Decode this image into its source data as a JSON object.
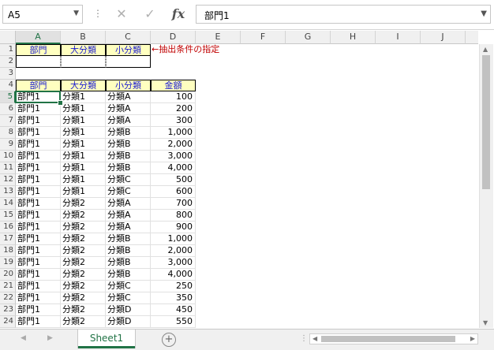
{
  "formula_bar": {
    "name_box": "A5",
    "formula": "部門1",
    "icons": [
      "cancel-icon",
      "enter-icon",
      "fx-icon"
    ]
  },
  "columns": [
    "A",
    "B",
    "C",
    "D",
    "E",
    "F",
    "G",
    "H",
    "I",
    "J"
  ],
  "criteria": {
    "headers": [
      "部門",
      "大分類",
      "小分類"
    ],
    "note": "←抽出条件の指定"
  },
  "list_headers": [
    "部門",
    "大分類",
    "小分類",
    "金額"
  ],
  "rows": [
    {
      "r": "5",
      "a": "部門1",
      "b": "分類1",
      "c": "分類A",
      "d": "100"
    },
    {
      "r": "6",
      "a": "部門1",
      "b": "分類1",
      "c": "分類A",
      "d": "200"
    },
    {
      "r": "7",
      "a": "部門1",
      "b": "分類1",
      "c": "分類A",
      "d": "300"
    },
    {
      "r": "8",
      "a": "部門1",
      "b": "分類1",
      "c": "分類B",
      "d": "1,000"
    },
    {
      "r": "9",
      "a": "部門1",
      "b": "分類1",
      "c": "分類B",
      "d": "2,000"
    },
    {
      "r": "10",
      "a": "部門1",
      "b": "分類1",
      "c": "分類B",
      "d": "3,000"
    },
    {
      "r": "11",
      "a": "部門1",
      "b": "分類1",
      "c": "分類B",
      "d": "4,000"
    },
    {
      "r": "12",
      "a": "部門1",
      "b": "分類1",
      "c": "分類C",
      "d": "500"
    },
    {
      "r": "13",
      "a": "部門1",
      "b": "分類1",
      "c": "分類C",
      "d": "600"
    },
    {
      "r": "14",
      "a": "部門1",
      "b": "分類2",
      "c": "分類A",
      "d": "700"
    },
    {
      "r": "15",
      "a": "部門1",
      "b": "分類2",
      "c": "分類A",
      "d": "800"
    },
    {
      "r": "16",
      "a": "部門1",
      "b": "分類2",
      "c": "分類A",
      "d": "900"
    },
    {
      "r": "17",
      "a": "部門1",
      "b": "分類2",
      "c": "分類B",
      "d": "1,000"
    },
    {
      "r": "18",
      "a": "部門1",
      "b": "分類2",
      "c": "分類B",
      "d": "2,000"
    },
    {
      "r": "19",
      "a": "部門1",
      "b": "分類2",
      "c": "分類B",
      "d": "3,000"
    },
    {
      "r": "20",
      "a": "部門1",
      "b": "分類2",
      "c": "分類B",
      "d": "4,000"
    },
    {
      "r": "21",
      "a": "部門1",
      "b": "分類2",
      "c": "分類C",
      "d": "250"
    },
    {
      "r": "22",
      "a": "部門1",
      "b": "分類2",
      "c": "分類C",
      "d": "350"
    },
    {
      "r": "23",
      "a": "部門1",
      "b": "分類2",
      "c": "分類D",
      "d": "450"
    },
    {
      "r": "24",
      "a": "部門1",
      "b": "分類2",
      "c": "分類D",
      "d": "550"
    }
  ],
  "sheet_tab": "Sheet1",
  "add_sheet": "+",
  "colors": {
    "accent": "#217346",
    "header_fill": "#ffffc0",
    "header_text": "#1a1ad0",
    "note": "#c00000"
  }
}
